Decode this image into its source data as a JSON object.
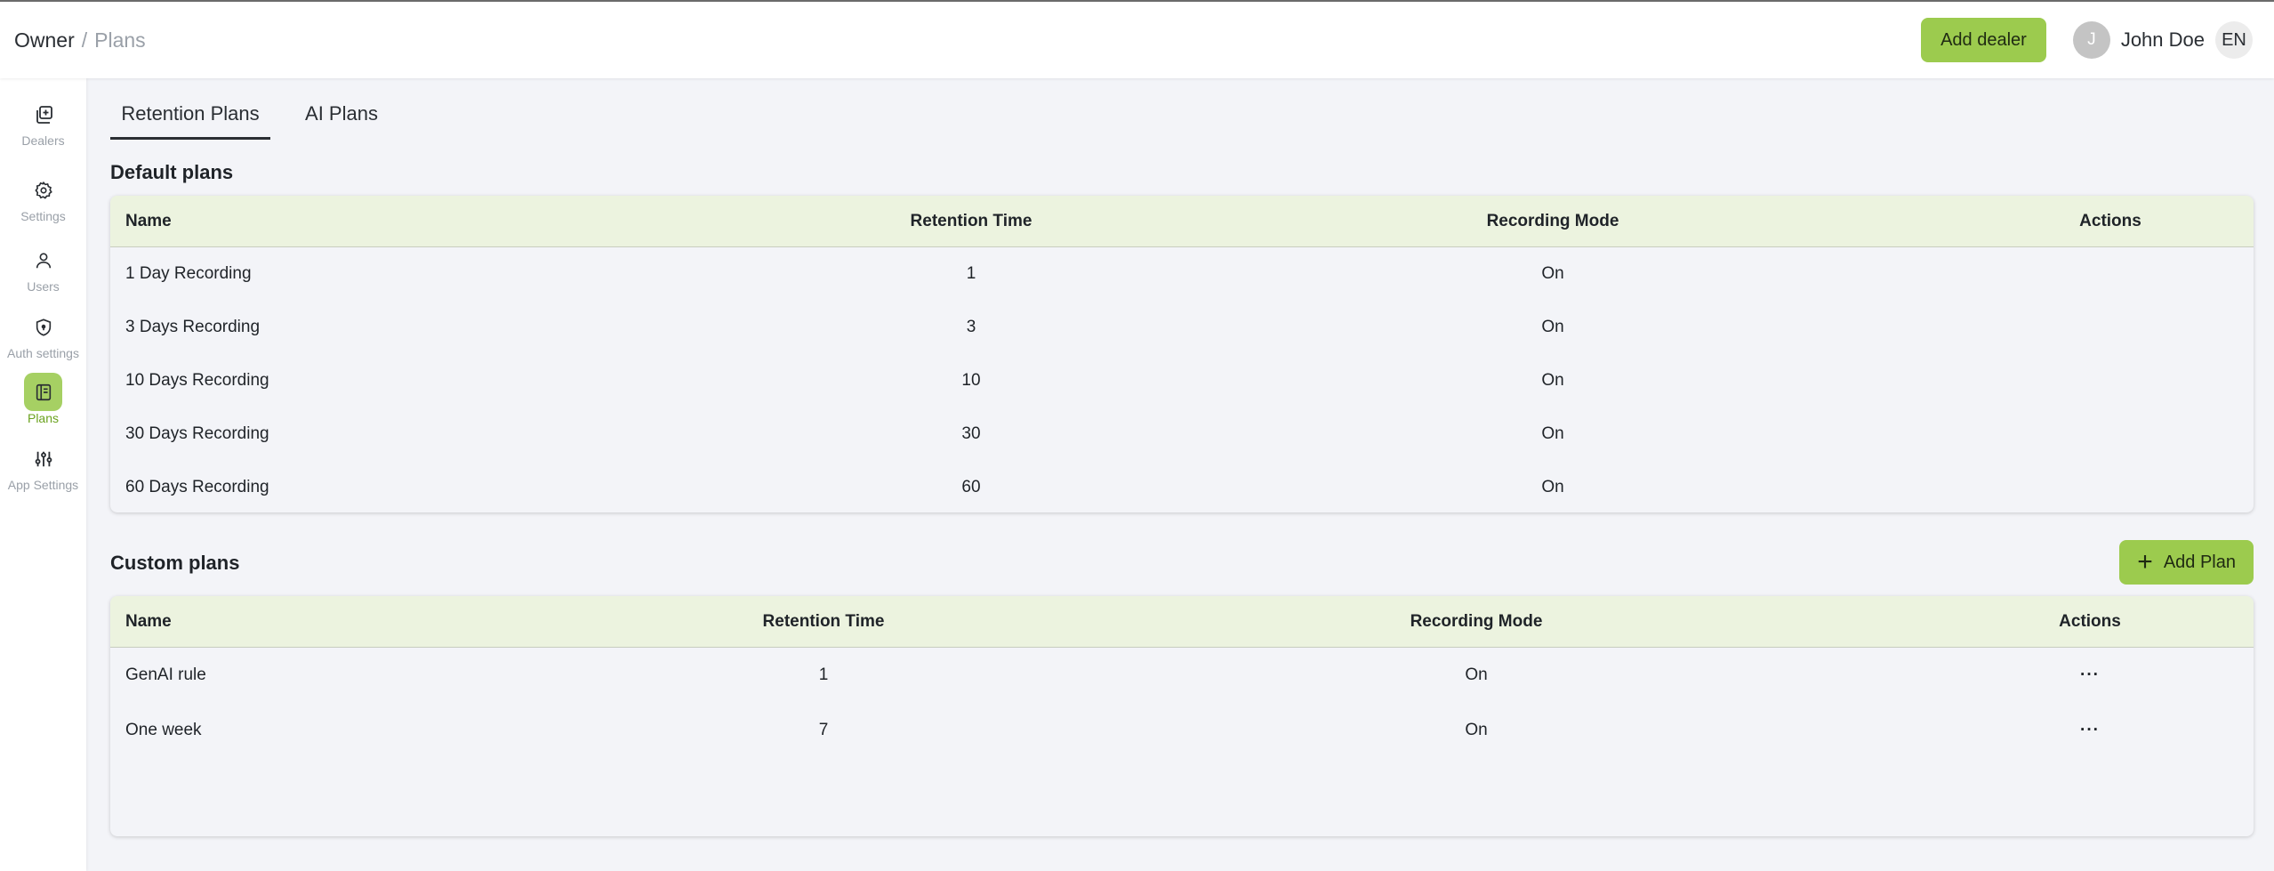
{
  "header": {
    "breadcrumb_root": "Owner",
    "breadcrumb_sep": "/",
    "breadcrumb_current": "Plans",
    "add_dealer_label": "Add dealer",
    "avatar_initial": "J",
    "user_name": "John Doe",
    "language": "EN"
  },
  "sidebar": {
    "items": [
      {
        "label": "Dealers",
        "icon": "dealers-icon"
      },
      {
        "label": "Settings",
        "icon": "gear-icon"
      },
      {
        "label": "Users",
        "icon": "user-icon"
      },
      {
        "label": "Auth settings",
        "icon": "shield-icon"
      },
      {
        "label": "Plans",
        "icon": "plans-icon",
        "active": true
      },
      {
        "label": "App Settings",
        "icon": "sliders-icon"
      }
    ]
  },
  "tabs": [
    {
      "label": "Retention Plans",
      "active": true
    },
    {
      "label": "AI Plans",
      "active": false
    }
  ],
  "default_plans": {
    "title": "Default plans",
    "columns": [
      "Name",
      "Retention Time",
      "Recording Mode",
      "Actions"
    ],
    "rows": [
      {
        "name": "1 Day Recording",
        "retention": "1",
        "mode": "On"
      },
      {
        "name": "3 Days Recording",
        "retention": "3",
        "mode": "On"
      },
      {
        "name": "10 Days Recording",
        "retention": "10",
        "mode": "On"
      },
      {
        "name": "30 Days Recording",
        "retention": "30",
        "mode": "On"
      },
      {
        "name": "60 Days Recording",
        "retention": "60",
        "mode": "On"
      }
    ]
  },
  "custom_plans": {
    "title": "Custom plans",
    "add_label": "Add Plan",
    "columns": [
      "Name",
      "Retention Time",
      "Recording Mode",
      "Actions"
    ],
    "rows": [
      {
        "name": "GenAI rule",
        "retention": "1",
        "mode": "On",
        "action": "···"
      },
      {
        "name": "One week",
        "retention": "7",
        "mode": "On",
        "action": "···"
      }
    ]
  },
  "colors": {
    "accent": "#9ccb4e",
    "header_row_bg": "#ecf3df",
    "page_bg": "#f3f4f8"
  }
}
